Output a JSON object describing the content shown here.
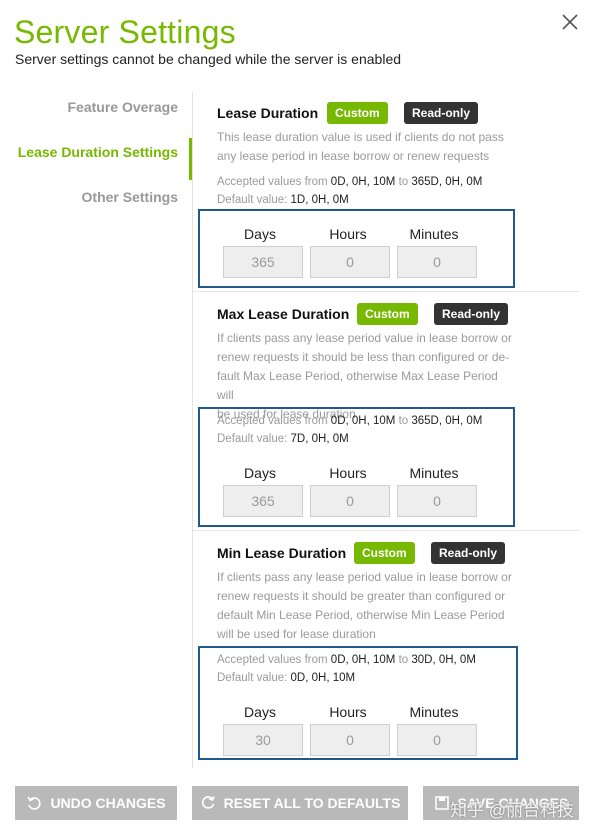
{
  "header": {
    "title": "Server Settings",
    "subtitle": "Server settings cannot be changed while the server is enabled",
    "close_icon": "close-icon"
  },
  "sidebar": {
    "items": [
      {
        "label": "Feature Overage",
        "active": false
      },
      {
        "label": "Lease Duration Settings",
        "active": true
      },
      {
        "label": "Other Settings",
        "active": false
      }
    ]
  },
  "columns": {
    "days": "Days",
    "hours": "Hours",
    "minutes": "Minutes"
  },
  "sections": [
    {
      "title": "Lease Duration",
      "badge_custom": "Custom",
      "badge_readonly": "Read-only",
      "description_lines": [
        "This lease duration value is used if clients do not pass",
        "any lease period in lease borrow or renew requests"
      ],
      "accepted_prefix": "Accepted values from",
      "accepted_min": "0D, 0H, 10M",
      "accepted_to": "to",
      "accepted_max": "365D, 0H, 0M",
      "default_prefix": "Default value:",
      "default_value": "1D, 0H, 0M",
      "days": "365",
      "hours": "0",
      "minutes": "0"
    },
    {
      "title": "Max Lease Duration",
      "badge_custom": "Custom",
      "badge_readonly": "Read-only",
      "description_lines": [
        "If clients pass any lease period value in lease borrow or",
        "renew requests it should be less than configured or de-",
        "fault Max Lease Period, otherwise Max Lease Period will",
        "be used for lease duration"
      ],
      "accepted_prefix": "Accepted values from",
      "accepted_min": "0D, 0H, 10M",
      "accepted_to": "to",
      "accepted_max": "365D, 0H, 0M",
      "default_prefix": "Default value:",
      "default_value": "7D, 0H, 0M",
      "days": "365",
      "hours": "0",
      "minutes": "0"
    },
    {
      "title": "Min Lease Duration",
      "badge_custom": "Custom",
      "badge_readonly": "Read-only",
      "description_lines": [
        "If clients pass any lease period value in lease borrow or",
        "renew requests it should be greater than configured or",
        "default Min Lease Period, otherwise Min Lease Period",
        "will be used for lease duration"
      ],
      "accepted_prefix": "Accepted values from",
      "accepted_min": "0D, 0H, 10M",
      "accepted_to": "to",
      "accepted_max": "30D, 0H, 0M",
      "default_prefix": "Default value:",
      "default_value": "0D, 0H, 10M",
      "days": "30",
      "hours": "0",
      "minutes": "0"
    }
  ],
  "footer": {
    "undo_label": "UNDO CHANGES",
    "reset_label": "RESET ALL TO DEFAULTS",
    "save_label": "SAVE CHANGES",
    "watermark": "知乎 @丽台科技"
  },
  "colors": {
    "accent": "#76b900",
    "readonly": "#333333",
    "highlight_box": "#1e5b8a",
    "button_disabled": "#b9b9b9"
  }
}
